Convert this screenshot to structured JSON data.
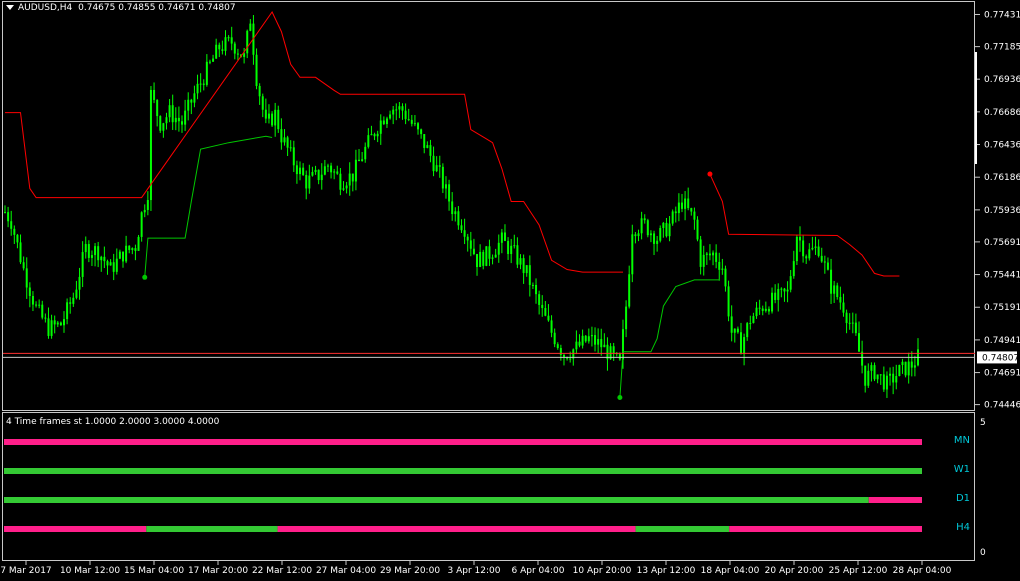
{
  "header": {
    "symbol_tf": "AUDUSD,H4",
    "ohlc": "0.74675 0.74855 0.74671 0.74807"
  },
  "subwindow": {
    "title": "4 Time frames st 1.0000 2.0000 3.0000 4.0000",
    "scale_top": "5",
    "scale_bottom": "0"
  },
  "colors": {
    "background": "#000000",
    "frame": "#c8c8c8",
    "candle": "#00ff00",
    "trail_up": "#00c800",
    "trail_down": "#ff0000",
    "price_line": "#ff3030",
    "bar_up": "#34c934",
    "bar_down": "#ff1f8a",
    "label": "#00c8d8"
  },
  "price_axis": {
    "ticks": [
      "0.77431",
      "0.77185",
      "0.76936",
      "0.76686",
      "0.76436",
      "0.76186",
      "0.75936",
      "0.75691",
      "0.75441",
      "0.75191",
      "0.74941",
      "0.74691",
      "0.74446"
    ],
    "current_price": "0.74807"
  },
  "time_axis": {
    "labels": [
      "7 Mar 2017",
      "10 Mar 12:00",
      "15 Mar 04:00",
      "17 Mar 20:00",
      "22 Mar 12:00",
      "27 Mar 04:00",
      "29 Mar 20:00",
      "3 Apr 12:00",
      "6 Apr 04:00",
      "10 Apr 20:00",
      "13 Apr 12:00",
      "18 Apr 04:00",
      "20 Apr 20:00",
      "25 Apr 12:00",
      "28 Apr 04:00"
    ]
  },
  "timeframes": [
    {
      "label": "MN",
      "segments": [
        {
          "from": 0,
          "to": 1,
          "state": "down"
        }
      ]
    },
    {
      "label": "W1",
      "segments": [
        {
          "from": 0,
          "to": 1,
          "state": "up"
        }
      ]
    },
    {
      "label": "D1",
      "segments": [
        {
          "from": 0,
          "to": 0.942,
          "state": "up"
        },
        {
          "from": 0.942,
          "to": 1,
          "state": "down"
        }
      ]
    },
    {
      "label": "H4",
      "segments": [
        {
          "from": 0,
          "to": 0.155,
          "state": "down"
        },
        {
          "from": 0.155,
          "to": 0.298,
          "state": "up"
        },
        {
          "from": 0.298,
          "to": 0.688,
          "state": "down"
        },
        {
          "from": 0.688,
          "to": 0.79,
          "state": "up"
        },
        {
          "from": 0.79,
          "to": 1,
          "state": "down"
        }
      ]
    }
  ],
  "chart_data": {
    "type": "candlestick",
    "symbol": "AUDUSD",
    "timeframe": "H4",
    "ylim": [
      0.7442,
      0.7745
    ],
    "close_path": [
      [
        0,
        0.7592
      ],
      [
        2,
        0.7585
      ],
      [
        6,
        0.7548
      ],
      [
        10,
        0.7518
      ],
      [
        14,
        0.7503
      ],
      [
        18,
        0.7506
      ],
      [
        22,
        0.7527
      ],
      [
        26,
        0.7564
      ],
      [
        30,
        0.7562
      ],
      [
        34,
        0.7548
      ],
      [
        38,
        0.756
      ],
      [
        42,
        0.7566
      ],
      [
        44,
        0.759
      ],
      [
        46,
        0.7608
      ],
      [
        47,
        0.7682
      ],
      [
        50,
        0.766
      ],
      [
        53,
        0.7668
      ],
      [
        57,
        0.766
      ],
      [
        61,
        0.7682
      ],
      [
        65,
        0.77
      ],
      [
        69,
        0.7718
      ],
      [
        73,
        0.7722
      ],
      [
        77,
        0.771
      ],
      [
        79,
        0.774
      ],
      [
        81,
        0.7695
      ],
      [
        84,
        0.7658
      ],
      [
        87,
        0.7667
      ],
      [
        89,
        0.765
      ],
      [
        93,
        0.763
      ],
      [
        97,
        0.7615
      ],
      [
        101,
        0.762
      ],
      [
        104,
        0.7628
      ],
      [
        108,
        0.7616
      ],
      [
        112,
        0.762
      ],
      [
        116,
        0.764
      ],
      [
        120,
        0.7658
      ],
      [
        124,
        0.7672
      ],
      [
        128,
        0.767
      ],
      [
        132,
        0.7656
      ],
      [
        136,
        0.764
      ],
      [
        140,
        0.762
      ],
      [
        144,
        0.7595
      ],
      [
        148,
        0.758
      ],
      [
        152,
        0.7555
      ],
      [
        156,
        0.756
      ],
      [
        160,
        0.757
      ],
      [
        164,
        0.756
      ],
      [
        168,
        0.7545
      ],
      [
        172,
        0.752
      ],
      [
        176,
        0.75
      ],
      [
        180,
        0.7483
      ],
      [
        184,
        0.7488
      ],
      [
        188,
        0.7495
      ],
      [
        192,
        0.749
      ],
      [
        196,
        0.748
      ],
      [
        198,
        0.7475
      ],
      [
        200,
        0.752
      ],
      [
        202,
        0.758
      ],
      [
        206,
        0.7582
      ],
      [
        210,
        0.7572
      ],
      [
        214,
        0.7582
      ],
      [
        218,
        0.76
      ],
      [
        222,
        0.7585
      ],
      [
        224,
        0.7555
      ],
      [
        228,
        0.756
      ],
      [
        231,
        0.755
      ],
      [
        234,
        0.75
      ],
      [
        237,
        0.749
      ],
      [
        240,
        0.751
      ],
      [
        244,
        0.752
      ],
      [
        248,
        0.7525
      ],
      [
        252,
        0.753
      ],
      [
        255,
        0.7575
      ],
      [
        258,
        0.756
      ],
      [
        262,
        0.7565
      ],
      [
        266,
        0.7535
      ],
      [
        270,
        0.752
      ],
      [
        274,
        0.7495
      ],
      [
        277,
        0.7465
      ],
      [
        280,
        0.747
      ],
      [
        284,
        0.746
      ],
      [
        288,
        0.747
      ],
      [
        292,
        0.7475
      ],
      [
        294,
        0.7481
      ]
    ],
    "trail_down_path": [
      [
        0,
        0.7668
      ],
      [
        5,
        0.7668
      ],
      [
        8,
        0.761
      ],
      [
        10,
        0.7603
      ],
      [
        44,
        0.7603
      ],
      [
        86,
        0.7745
      ],
      [
        89,
        0.773
      ],
      [
        92,
        0.7705
      ],
      [
        95,
        0.7695
      ],
      [
        100,
        0.7695
      ],
      [
        106,
        0.7685
      ],
      [
        108,
        0.7682
      ],
      [
        135,
        0.7682
      ],
      [
        148,
        0.7682
      ],
      [
        150,
        0.7655
      ],
      [
        155,
        0.7648
      ],
      [
        157,
        0.7645
      ],
      [
        160,
        0.7625
      ],
      [
        163,
        0.76
      ],
      [
        167,
        0.76
      ],
      [
        172,
        0.7582
      ],
      [
        176,
        0.7555
      ],
      [
        181,
        0.7548
      ],
      [
        186,
        0.7546
      ],
      [
        199,
        0.7546
      ]
    ],
    "trail_down_path_2": [
      [
        227,
        0.7621
      ],
      [
        231,
        0.76
      ],
      [
        233,
        0.7575
      ],
      [
        268,
        0.7574
      ],
      [
        272,
        0.7567
      ],
      [
        276,
        0.7559
      ],
      [
        280,
        0.7545
      ],
      [
        283,
        0.7543
      ],
      [
        288,
        0.7543
      ]
    ],
    "trail_up_path": [
      [
        45,
        0.7542
      ],
      [
        46,
        0.7572
      ],
      [
        58,
        0.7572
      ],
      [
        60,
        0.76
      ],
      [
        63,
        0.764
      ],
      [
        72,
        0.7645
      ],
      [
        84,
        0.765
      ],
      [
        86,
        0.7649
      ]
    ],
    "trail_up_path_2": [
      [
        198,
        0.745
      ],
      [
        199,
        0.7485
      ],
      [
        208,
        0.7485
      ],
      [
        210,
        0.7495
      ],
      [
        212,
        0.752
      ],
      [
        216,
        0.7535
      ],
      [
        222,
        0.754
      ],
      [
        230,
        0.754
      ]
    ],
    "trail_dots": [
      {
        "x": 45,
        "y": 0.7542,
        "state": "up"
      },
      {
        "x": 198,
        "y": 0.745,
        "state": "up"
      },
      {
        "x": 227,
        "y": 0.7621,
        "state": "down"
      }
    ],
    "candles_total": 295
  }
}
